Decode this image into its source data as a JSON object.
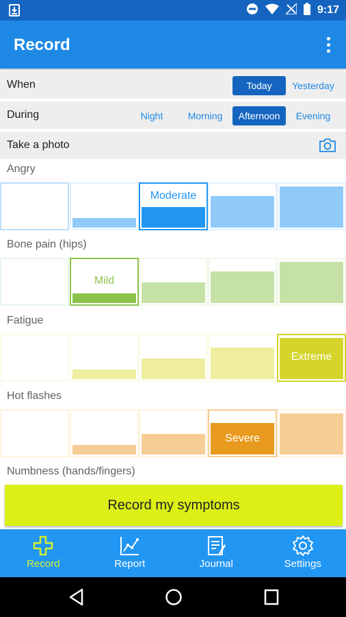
{
  "status_bar": {
    "time": "9:17"
  },
  "app_bar": {
    "title": "Record"
  },
  "when": {
    "label": "When",
    "options": [
      "Today",
      "Yesterday"
    ],
    "selected": "Today"
  },
  "during": {
    "label": "During",
    "options": [
      "Night",
      "Morning",
      "Afternoon",
      "Evening"
    ],
    "selected": "Afternoon"
  },
  "photo": {
    "label": "Take a photo"
  },
  "symptoms": [
    {
      "name": "Angry",
      "selected_label": "Moderate",
      "selected_level": 2,
      "color": "#2196f3",
      "light_color": "#90caf9"
    },
    {
      "name": "Bone pain (hips)",
      "selected_label": "Mild",
      "selected_level": 1,
      "color": "#8bc34a",
      "light_color": "#c5e1a5"
    },
    {
      "name": "Fatigue",
      "selected_label": "Extreme",
      "selected_level": 4,
      "color": "#d4d42a",
      "light_color": "#eeee9e"
    },
    {
      "name": "Hot flashes",
      "selected_label": "Severe",
      "selected_level": 3,
      "color": "#e89a1e",
      "light_color": "#f6cd95"
    },
    {
      "name": "Numbness (hands/fingers)"
    }
  ],
  "record_button": {
    "label": "Record my symptoms"
  },
  "bottom_nav": [
    {
      "label": "Record",
      "icon": "plus-icon",
      "active": true
    },
    {
      "label": "Report",
      "icon": "chart-icon",
      "active": false
    },
    {
      "label": "Journal",
      "icon": "journal-icon",
      "active": false
    },
    {
      "label": "Settings",
      "icon": "gear-icon",
      "active": false
    }
  ],
  "colors": {
    "primary": "#1e88e5",
    "primary_dark": "#1565c0",
    "accent": "#dcf016",
    "nav": "#2196f3"
  }
}
